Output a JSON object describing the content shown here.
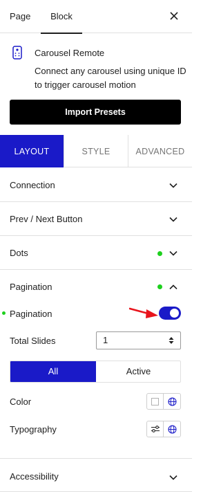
{
  "top_tabs": {
    "page": "Page",
    "block": "Block"
  },
  "block": {
    "icon": "remote-control-icon",
    "name": "Carousel Remote",
    "description": "Connect any carousel using unique ID to trigger carousel motion",
    "import_button": "Import Presets"
  },
  "settings_tabs": {
    "layout": "LAYOUT",
    "style": "STYLE",
    "advanced": "ADVANCED",
    "selected": "LAYOUT"
  },
  "panels": {
    "connection": {
      "title": "Connection",
      "expanded": false
    },
    "prev_next": {
      "title": "Prev / Next Button",
      "expanded": false
    },
    "dots": {
      "title": "Dots",
      "expanded": false,
      "modified": true
    },
    "pagination": {
      "title": "Pagination",
      "expanded": true,
      "modified": true
    },
    "accessibility": {
      "title": "Accessibility",
      "expanded": false
    }
  },
  "pagination": {
    "toggle_label": "Pagination",
    "toggle_on": true,
    "total_slides_label": "Total Slides",
    "total_slides_value": "1",
    "state_tabs": [
      "All",
      "Active"
    ],
    "selected_state": "All",
    "color_label": "Color",
    "typography_label": "Typography"
  },
  "colors": {
    "accent": "#1a1ac8",
    "modified_dot": "#1ed01e",
    "annotation_arrow": "#e8141c"
  }
}
